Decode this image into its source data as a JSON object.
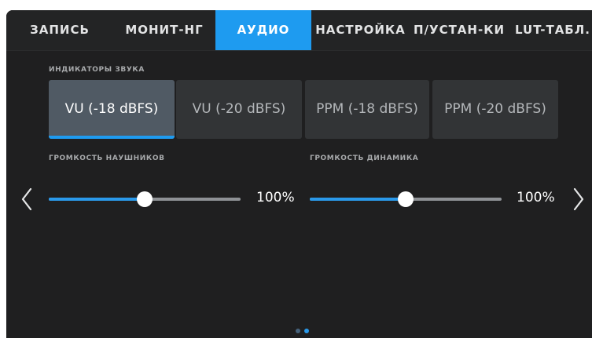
{
  "tabs": [
    {
      "label": "ЗАПИСЬ",
      "active": false
    },
    {
      "label": "МОНИТ-НГ",
      "active": false
    },
    {
      "label": "АУДИО",
      "active": true
    },
    {
      "label": "НАСТРОЙКА",
      "active": false
    },
    {
      "label": "П/УСТАН-КИ",
      "active": false
    },
    {
      "label": "LUT-ТАБЛ.",
      "active": false
    }
  ],
  "meters": {
    "label": "ИНДИКАТОРЫ ЗВУКА",
    "options": [
      {
        "label": "VU (-18 dBFS)",
        "selected": true
      },
      {
        "label": "VU (-20 dBFS)",
        "selected": false
      },
      {
        "label": "PPM (-18 dBFS)",
        "selected": false
      },
      {
        "label": "PPM (-20  dBFS)",
        "selected": false
      }
    ]
  },
  "headphone_volume": {
    "label": "ГРОМКОСТЬ НАУШНИКОВ",
    "value_text": "100%",
    "level": 0.5
  },
  "speaker_volume": {
    "label": "ГРОМКОСТЬ ДИНАМИКА",
    "value_text": "100%",
    "level": 0.5
  },
  "pagination": {
    "pages": 2,
    "current": 2
  },
  "icons": {
    "prev": "chevron-left-icon",
    "next": "chevron-right-icon"
  },
  "colors": {
    "accent": "#1e9bf0",
    "background": "#1f1f20",
    "tab_bar": "#232425",
    "selected_option": "#505a64",
    "option": "#323436",
    "slider_track": "#8e9195",
    "text": "#ffffff"
  }
}
